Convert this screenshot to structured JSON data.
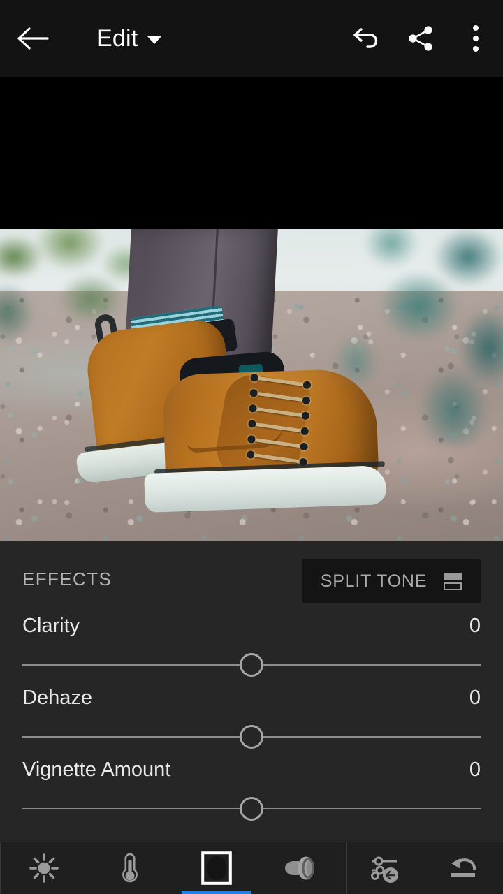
{
  "app": {
    "screen_title": "Edit"
  },
  "topbar": {
    "back_icon": "back-arrow-icon",
    "title": "Edit",
    "dropdown_icon": "chevron-down-icon",
    "undo_icon": "undo-icon",
    "share_icon": "share-icon",
    "overflow_icon": "more-vertical-icon"
  },
  "photo": {
    "subject": "tan high-top sneakers on gravel",
    "alt": "Person wearing tan suede high-top sneakers standing on gravel with teal foliage and pale sky"
  },
  "panel": {
    "title": "EFFECTS",
    "split_tone": {
      "label": "SPLIT TONE",
      "icon": "split-tone-icon"
    },
    "sliders": [
      {
        "label": "Clarity",
        "value": "0",
        "position_percent": 50
      },
      {
        "label": "Dehaze",
        "value": "0",
        "position_percent": 50
      },
      {
        "label": "Vignette Amount",
        "value": "0",
        "position_percent": 50
      }
    ]
  },
  "toolbar": {
    "items": [
      {
        "name": "light",
        "icon": "sun-icon",
        "active": false
      },
      {
        "name": "color",
        "icon": "thermometer-icon",
        "active": false
      },
      {
        "name": "effects",
        "icon": "vignette-icon",
        "active": true
      },
      {
        "name": "detail",
        "icon": "lens-icon",
        "active": false
      }
    ],
    "utilities": [
      {
        "name": "previous-edits",
        "icon": "sliders-back-icon"
      },
      {
        "name": "reset",
        "icon": "reset-icon"
      }
    ]
  },
  "colors": {
    "accent": "#2680eb",
    "topbar_bg": "#131313",
    "panel_bg": "#262626",
    "toolbar_bg": "#1f1f1f",
    "text_primary": "#e8e8e8",
    "text_muted": "#b4b4b4"
  }
}
